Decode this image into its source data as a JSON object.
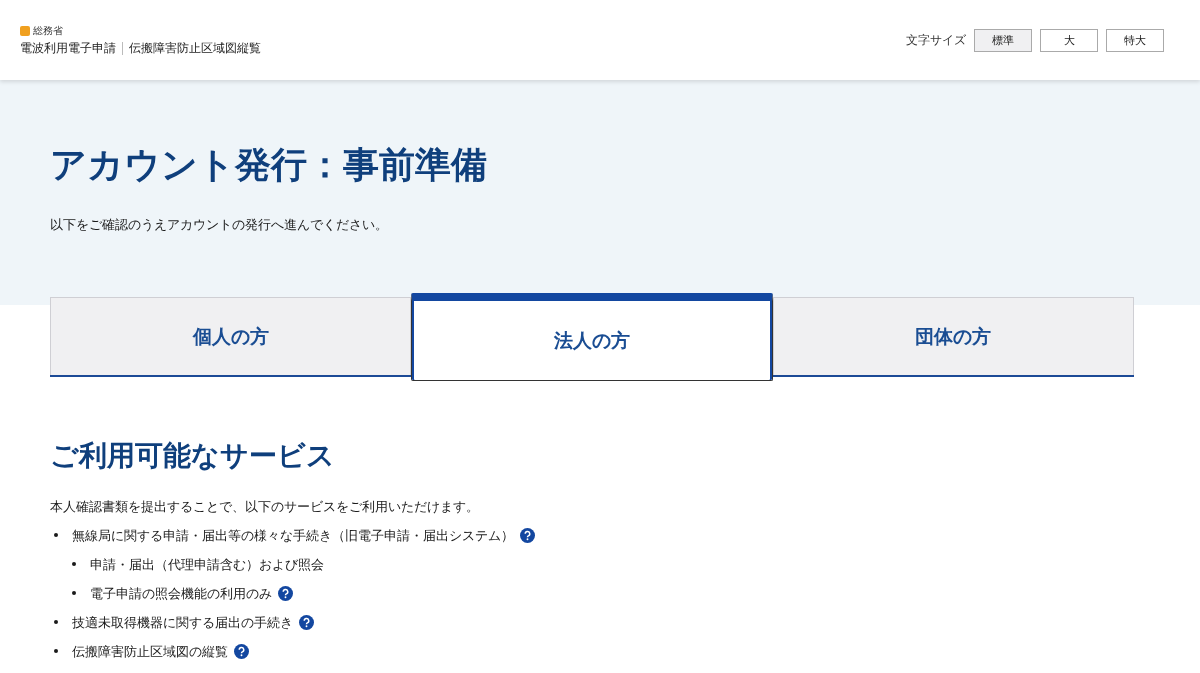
{
  "header": {
    "ministry": "総務省",
    "site_title": "電波利用電子申請",
    "sub_title": "伝搬障害防止区域図縦覧",
    "font_size_label": "文字サイズ",
    "font_sizes": [
      {
        "label": "標準",
        "selected": true
      },
      {
        "label": "大",
        "selected": false
      },
      {
        "label": "特大",
        "selected": false
      }
    ]
  },
  "hero": {
    "title": "アカウント発行：事前準備",
    "lead": "以下をご確認のうえアカウントの発行へ進んでください。"
  },
  "tabs": [
    {
      "label": "個人の方",
      "selected": false
    },
    {
      "label": "法人の方",
      "selected": true
    },
    {
      "label": "団体の方",
      "selected": false
    }
  ],
  "section": {
    "heading": "ご利用可能なサービス",
    "intro": "本人確認書類を提出することで、以下のサービスをご利用いただけます。",
    "services": [
      {
        "text": "無線局に関する申請・届出等の様々な手続き（旧電子申請・届出システム）",
        "help": true,
        "children": [
          {
            "text": "申請・届出（代理申請含む）および照会",
            "help": false
          },
          {
            "text": "電子申請の照会機能の利用のみ",
            "help": true
          }
        ]
      },
      {
        "text": "技適未取得機器に関する届出の手続き",
        "help": true
      },
      {
        "text": "伝搬障害防止区域図の縦覧",
        "help": true
      }
    ]
  }
}
